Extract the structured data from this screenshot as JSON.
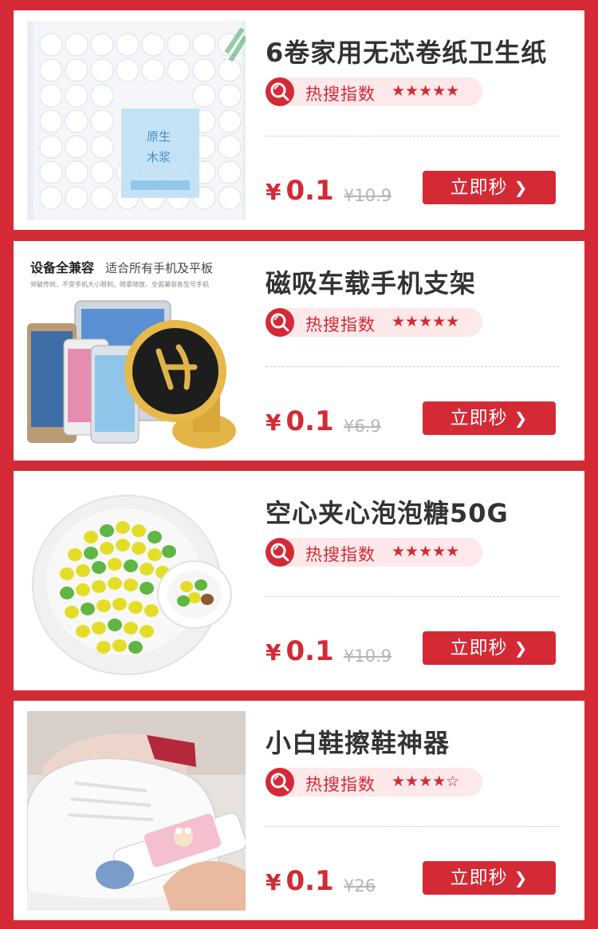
{
  "colors": {
    "accent": "#d42a35",
    "background": "#d42a35",
    "card": "#ffffff",
    "text": "#333333",
    "muted": "#b5b5b5",
    "badge_bg": "#fde8ea"
  },
  "common": {
    "hot_label": "热搜指数",
    "currency": "¥",
    "buy_label": "立即秒",
    "buy_icon": "chevron-right-icon",
    "hot_icon": "search-icon"
  },
  "products": [
    {
      "title": "6卷家用无芯卷纸卫生纸",
      "stars": "★★★★★",
      "rating": 5,
      "price": "0.1",
      "original_price": "¥10.9",
      "image_text": [
        "原生",
        "木浆"
      ]
    },
    {
      "title": "磁吸车载手机支架",
      "stars": "★★★★★",
      "rating": 5,
      "price": "0.1",
      "original_price": "¥6.9",
      "image_headline": "设备全兼容",
      "image_headline_rest": "适合所有手机及平板",
      "image_subline": "突破传统，不受手机大小限制，随拿随放，全面兼容各型号手机"
    },
    {
      "title": "空心夹心泡泡糖50G",
      "stars": "★★★★★",
      "rating": 5,
      "price": "0.1",
      "original_price": "¥10.9"
    },
    {
      "title": "小白鞋擦鞋神器",
      "stars": "★★★★☆",
      "rating": 4.5,
      "price": "0.1",
      "original_price": "¥26"
    }
  ]
}
